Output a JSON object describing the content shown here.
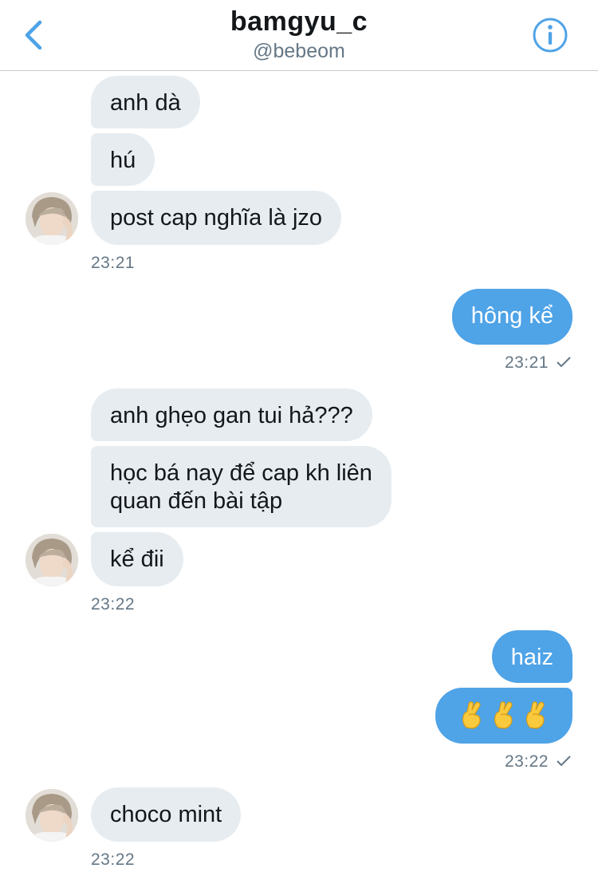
{
  "header": {
    "title": "bamgyu_c",
    "handle": "@bebeom",
    "back_icon": "chevron-left-icon",
    "info_icon": "info-icon",
    "accent_color": "#4fa3e7"
  },
  "messages": [
    {
      "side": "in",
      "text": "anh dà"
    },
    {
      "side": "in",
      "text": "hú"
    },
    {
      "side": "in",
      "text": "post cap nghĩa là jzo"
    },
    {
      "side": "in",
      "time": "23:21"
    },
    {
      "side": "out",
      "text": "hông kể"
    },
    {
      "side": "out",
      "time": "23:21"
    },
    {
      "side": "in",
      "text": "anh ghẹo gan tui hả???"
    },
    {
      "side": "in",
      "text_line1": "học bá nay để cap kh liên",
      "text_line2": "quan đến bài tập"
    },
    {
      "side": "in",
      "text": "kể đii"
    },
    {
      "side": "in",
      "time": "23:22"
    },
    {
      "side": "out",
      "text": "haiz"
    },
    {
      "side": "out",
      "emoji": "crossed-fingers-icon",
      "count": 3
    },
    {
      "side": "out",
      "time": "23:22"
    },
    {
      "side": "in",
      "text": "choco mint"
    },
    {
      "side": "in",
      "time": "23:22"
    }
  ]
}
